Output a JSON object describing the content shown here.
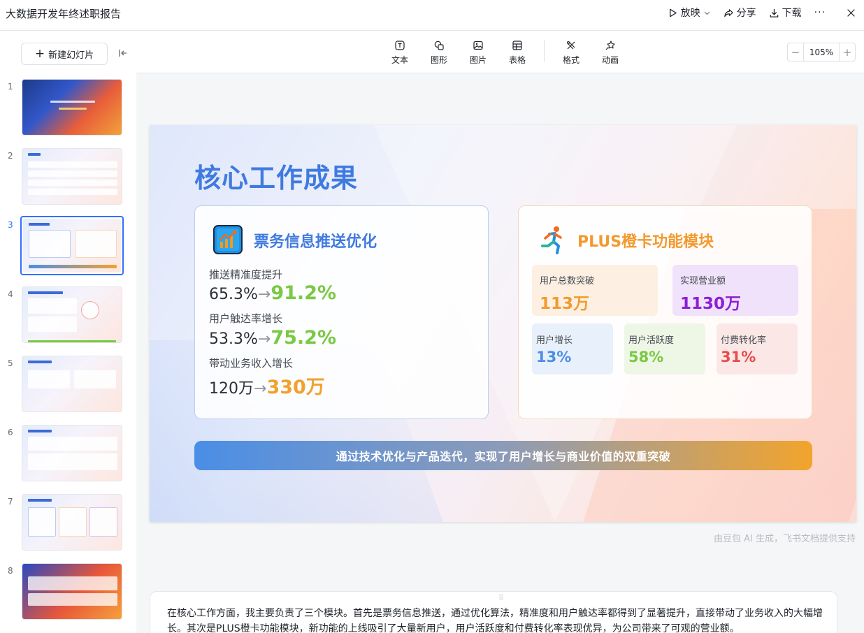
{
  "window": {
    "title": "大数据开发年终述职报告",
    "actions": {
      "present": "放映",
      "share": "分享",
      "download": "下载",
      "more": "···"
    }
  },
  "sidebar": {
    "new_slide_label": "新建幻灯片",
    "slides": [
      {
        "number": "1"
      },
      {
        "number": "2"
      },
      {
        "number": "3"
      },
      {
        "number": "4"
      },
      {
        "number": "5"
      },
      {
        "number": "6"
      },
      {
        "number": "7"
      },
      {
        "number": "8"
      }
    ],
    "active_slide": 3
  },
  "toolbar": {
    "tools": [
      {
        "label": "文本",
        "icon": "text-icon"
      },
      {
        "label": "图形",
        "icon": "shape-icon"
      },
      {
        "label": "图片",
        "icon": "image-icon"
      },
      {
        "label": "表格",
        "icon": "table-icon"
      },
      {
        "label": "格式",
        "icon": "format-icon"
      },
      {
        "label": "动画",
        "icon": "animation-icon"
      }
    ],
    "zoom": {
      "minus": "−",
      "value": "105%",
      "plus": "+"
    }
  },
  "slide": {
    "title": "核心工作成果",
    "left_card": {
      "title": "票务信息推送优化",
      "metrics": [
        {
          "label": "推送精准度提升",
          "from": "65.3%",
          "arrow": "→",
          "to": "91.2%"
        },
        {
          "label": "用户触达率增长",
          "from": "53.3%",
          "arrow": "→",
          "to": "75.2%"
        },
        {
          "label": "带动业务收入增长",
          "from": "120万",
          "arrow": "→",
          "to": "330万"
        }
      ]
    },
    "right_card": {
      "title": "PLUS橙卡功能模块",
      "stats_big": [
        {
          "label": "用户总数突破",
          "value": "113万"
        },
        {
          "label": "实现营业额",
          "value": "1130万"
        }
      ],
      "stats_small": [
        {
          "label": "用户增长",
          "value": "13%"
        },
        {
          "label": "用户活跃度",
          "value": "58%"
        },
        {
          "label": "付费转化率",
          "value": "31%"
        }
      ]
    },
    "banner": "通过技术优化与产品迭代，实现了用户增长与商业价值的双重突破"
  },
  "ai_note": "由豆包 AI 生成，飞书文档提供支持",
  "notes": {
    "text": "在核心工作方面，我主要负责了三个模块。首先是票务信息推送，通过优化算法，精准度和用户触达率都得到了显著提升，直接带动了业务收入的大幅增长。其次是PLUS橙卡功能模块，新功能的上线吸引了大量新用户，用户活跃度和付费转化率表现优异，为公司带来了可观的营业额。"
  },
  "colors": {
    "accent_blue": "#3f7ae0",
    "accent_orange": "#f29a2e",
    "highlight_green": "#7ac943",
    "selection": "#3370ff"
  }
}
